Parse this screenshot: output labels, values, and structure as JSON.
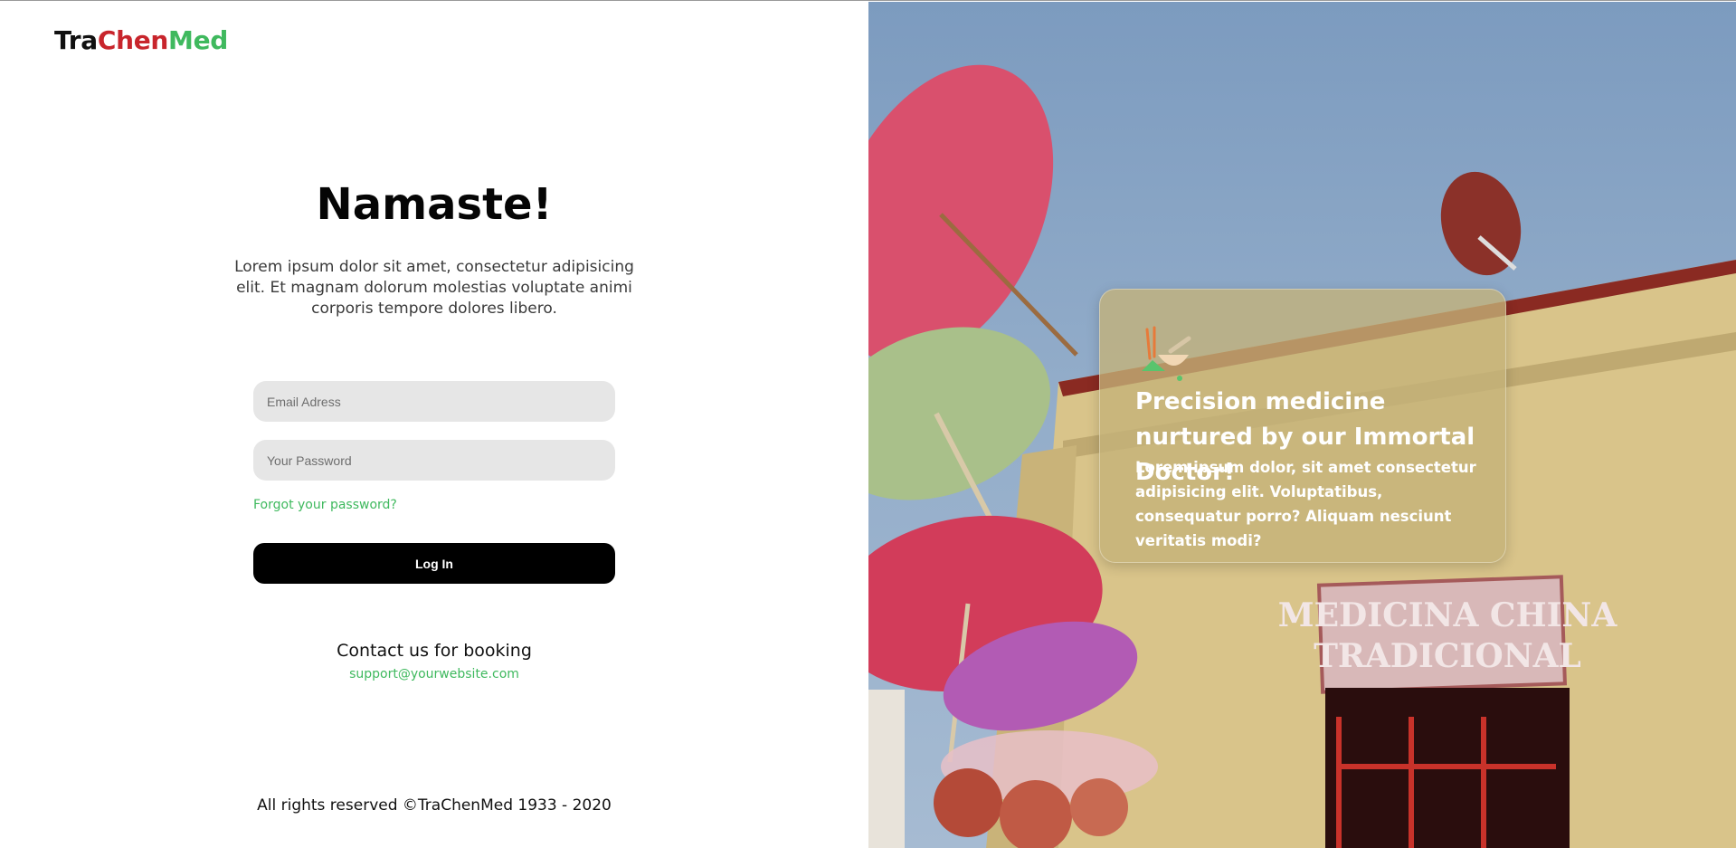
{
  "brand": {
    "logo_part1": "Tra",
    "logo_part2": "Chen",
    "logo_part3": "Med",
    "colors": {
      "dark": "#111111",
      "red": "#c8252c",
      "green": "#3fb95e"
    }
  },
  "login": {
    "title": "Namaste!",
    "intro": "Lorem ipsum dolor sit amet, consectetur adipisicing elit. Et magnam dolorum molestias voluptate animi corporis tempore dolores libero.",
    "email_placeholder": "Email Adress",
    "email_value": "",
    "password_placeholder": "Your Password",
    "password_value": "",
    "forgot_label": "Forgot your password?",
    "login_label": "Log In"
  },
  "contact": {
    "title": "Contact us for booking",
    "email": "support@yourwebsite.com"
  },
  "footer": {
    "text": "All rights reserved ©TraChenMed 1933 - 2020"
  },
  "promo": {
    "icon": "herbal-mortar-icon",
    "heading": "Precision medicine nurtured by our Immortal Doctor!",
    "text": "Lorem ipsum dolor, sit amet consectetur adipisicing elit. Voluptatibus, consequatur porro? Aliquam nesciunt veritatis modi?"
  },
  "scene": {
    "sign_line1": "MEDICINA CHINA",
    "sign_line2": "TRADICIONAL"
  }
}
